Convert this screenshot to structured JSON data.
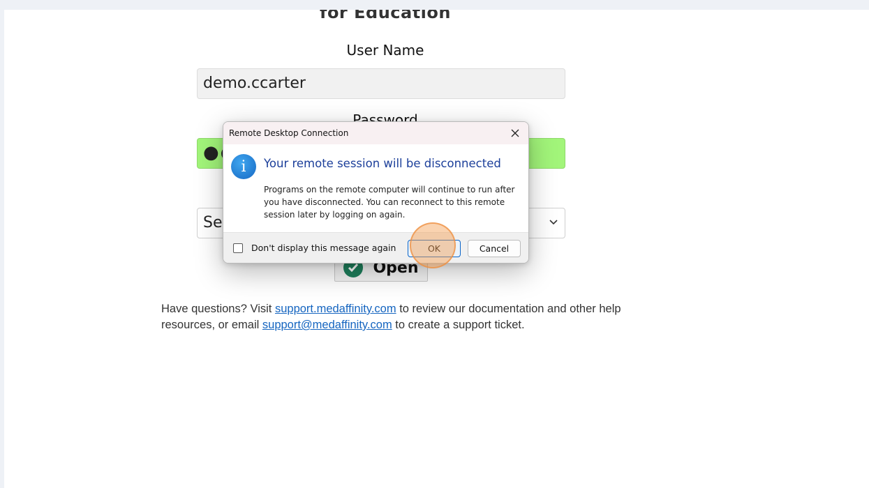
{
  "app": {
    "subtitle": "for Education"
  },
  "login": {
    "username_label": "User Name",
    "username_value": "demo.ccarter",
    "password_label": "Password",
    "password_value": "●●",
    "select_value": "Sel",
    "open_label": "Open"
  },
  "help": {
    "part1": "Have questions? Visit ",
    "link1": " support.medaffinity.com",
    "part2": " to review our documentation and other help resources, or email ",
    "link2": "support@medaffinity.com",
    "part3": "  to create a support ticket."
  },
  "dialog": {
    "title": "Remote Desktop Connection",
    "heading": "Your remote session will be disconnected",
    "message": "Programs on the remote computer will continue to run after you have disconnected. You can reconnect to this remote session later by logging on again.",
    "checkbox_label": "Don't display this message again",
    "ok_label": "OK",
    "cancel_label": "Cancel",
    "info_glyph": "i"
  },
  "icons": {
    "info": "info-icon",
    "close": "close-icon",
    "check": "check-icon",
    "chevron": "chevron-down-icon"
  },
  "colors": {
    "password_ok": "#a2f57a",
    "dialog_heading": "#1c3f9a",
    "link": "#1565c0",
    "ok_border": "#0a64c8",
    "highlight": "#f59e50"
  }
}
